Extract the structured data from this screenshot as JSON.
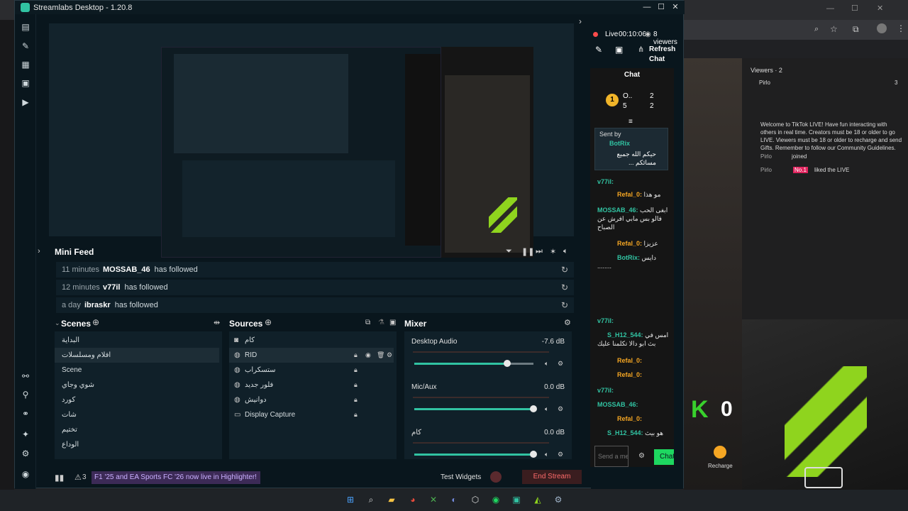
{
  "window": {
    "title": "Streamlabs Desktop - 1.20.8"
  },
  "live": {
    "label": "Live",
    "time": "00:10:06",
    "viewers": "8 viewers"
  },
  "toolbar_right": {
    "refresh_chat": "Refresh Chat"
  },
  "chat": {
    "title": "Chat",
    "leaderboard": {
      "first_label": "O..",
      "first_num": "1",
      "second": "2",
      "third_row_a": "5",
      "third_row_b": "2"
    },
    "pinned": {
      "sent_by": "Sent by",
      "user": "BotRix",
      "text": "حيكم الله جميع مسائكم ..."
    },
    "messages": [
      {
        "user": "v77il:",
        "text": ""
      },
      {
        "user": "Refal_0:",
        "text": "مو هذا"
      },
      {
        "user": "MOSSAB_46:",
        "text": "ابغى الحب فالو بس مابي افرش عن الصباح"
      },
      {
        "user": "Refal_0:",
        "text": "عزيزا"
      },
      {
        "user": "BotRix:",
        "text": "دايس ........"
      },
      {
        "user": "v77il:",
        "text": ""
      },
      {
        "user": "S_H12_544:",
        "text": "امس في بث ابو دالا تكلمنا عليك"
      },
      {
        "user": "Refal_0:",
        "text": ""
      },
      {
        "user": "Refal_0:",
        "text": ""
      },
      {
        "user": "v77il:",
        "text": ""
      },
      {
        "user": "MOSSAB_46:",
        "text": ""
      },
      {
        "user": "Refal_0:",
        "text": ""
      },
      {
        "user": "S_H12_544:",
        "text": "هو بيث"
      }
    ],
    "input_placeholder": "Send a message",
    "send_label": "Chat"
  },
  "mini_feed": {
    "title": "Mini Feed",
    "rows": [
      {
        "time": "11 minutes",
        "user": "MOSSAB_46",
        "action": "has followed"
      },
      {
        "time": "12 minutes",
        "user": "v77il",
        "action": "has followed"
      },
      {
        "time": "a day",
        "user": "ibraskr",
        "action": "has followed"
      }
    ]
  },
  "scenes": {
    "title": "Scenes",
    "items": [
      "البداية",
      "افلام ومسلسلات",
      "Scene",
      "شوي وجاي",
      "كورد",
      "شات",
      "تختيم",
      "الوداع"
    ]
  },
  "sources": {
    "title": "Sources",
    "items": [
      "كام",
      "RID",
      "ستسكراب",
      "فلور جديد",
      "دوانيش",
      "Display Capture"
    ]
  },
  "mixer": {
    "title": "Mixer",
    "channels": [
      {
        "name": "Desktop Audio",
        "db": "-7.6 dB",
        "level": 0.78
      },
      {
        "name": "Mic/Aux",
        "db": "0.0 dB",
        "level": 1.0
      },
      {
        "name": "كام",
        "db": "0.0 dB",
        "level": 1.0
      }
    ]
  },
  "footer": {
    "alerts": "3",
    "highlighter": "F1 '25 and EA Sports FC '26 now live in Highlighter!",
    "test_widgets": "Test Widgets",
    "end_stream": "End Stream"
  },
  "tiktok": {
    "viewers_label": "Viewers · 2",
    "viewer1": "Pirlo",
    "viewer1_count": "3",
    "welcome": "Welcome to TikTok LIVE! Have fun interacting with others in real time. Creators must be 18 or older to go LIVE. Viewers must be 18 or older to recharge and send Gifts. Remember to follow our Community Guidelines.",
    "event1_user": "Pirlo",
    "event1_text": "joined",
    "event2_user": "Pirlo",
    "event2_badge": "No.1",
    "event2_text": "liked the LIVE",
    "recharge": "Recharge",
    "k_score": "0"
  },
  "colors": {
    "accent": "#31c3a2",
    "end_stream": "#ff6b6b",
    "highlight_bg": "#3c2a56",
    "username": "#31c3a2",
    "orange_user": "#f5a623"
  }
}
